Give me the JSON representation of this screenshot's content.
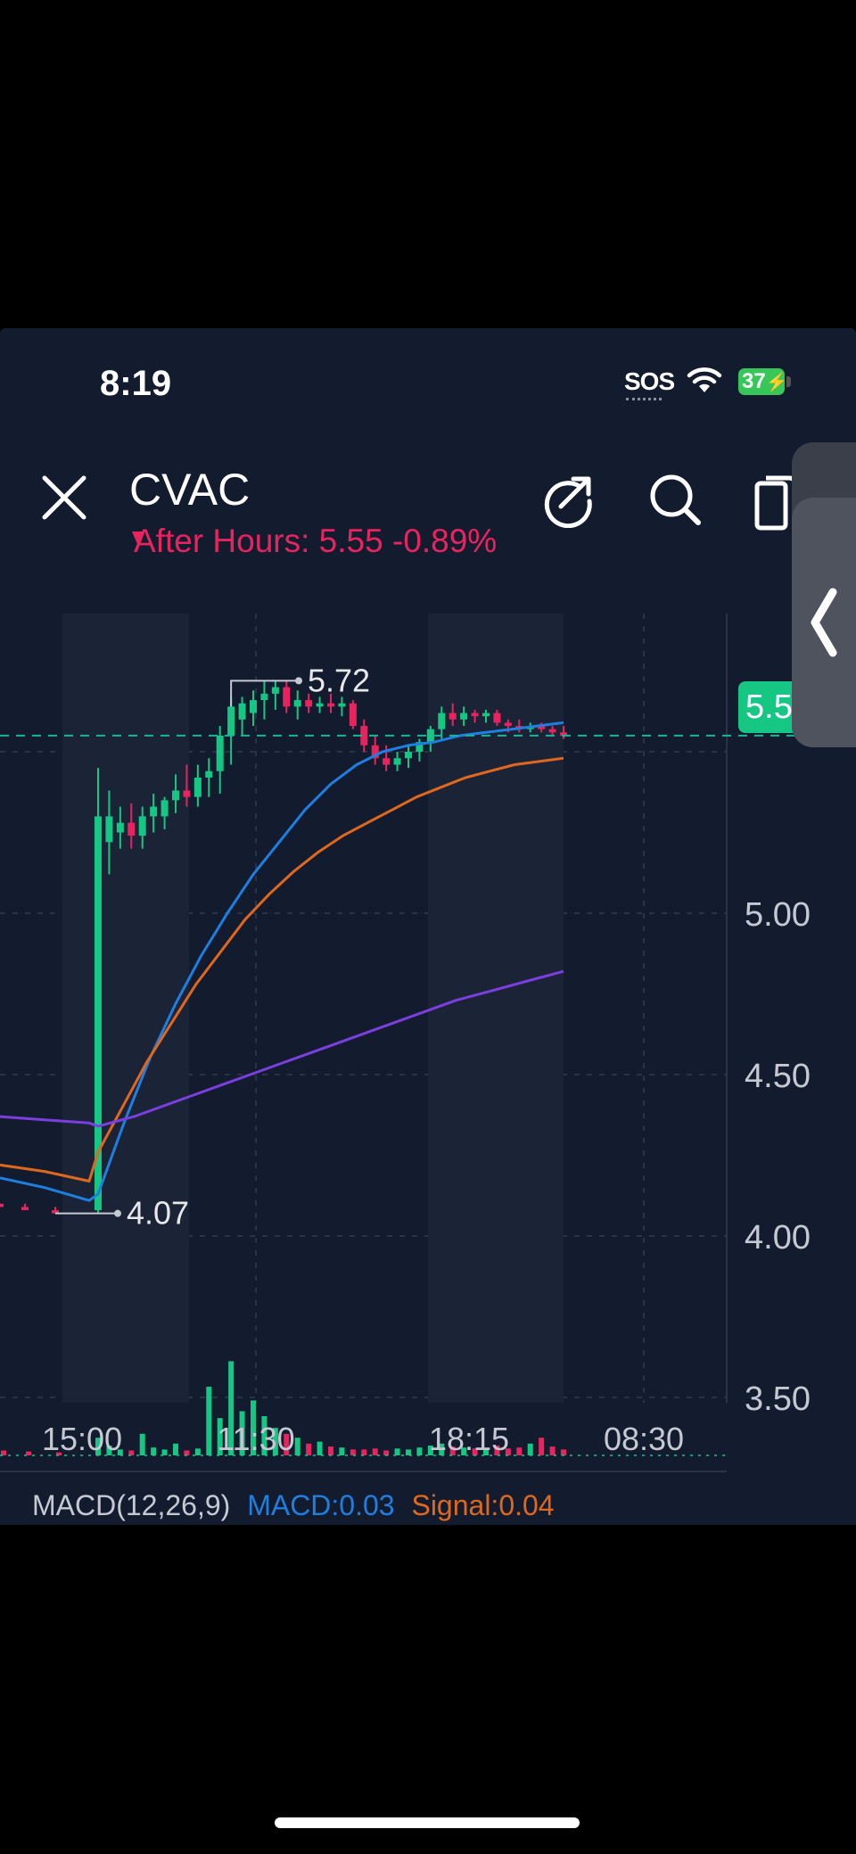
{
  "status_bar": {
    "time": "8:19",
    "sos": "SOS",
    "battery": "37"
  },
  "header": {
    "ticker": "CVAC",
    "after_hours": "After Hours: 5.55 -0.89%",
    "icons": [
      "close-icon",
      "share-icon",
      "search-icon",
      "copy-icon",
      "chevron-left-icon"
    ]
  },
  "colors": {
    "background": "#131b2e",
    "up": "#16c784",
    "down": "#e8245f",
    "ma_short": "#1e7fe0",
    "ma_mid": "#e0681e",
    "ma_long": "#7b3fe0",
    "accent_text": "#e8245f"
  },
  "chart_data": {
    "type": "candlestick",
    "y_ticks": [
      "5.00",
      "4.50",
      "4.00",
      "3.50"
    ],
    "x_ticks": [
      "15:00",
      "11:30",
      "18:15",
      "08:30"
    ],
    "last_price_label": "5.5",
    "last_price": 5.55,
    "high_label": "5.72",
    "high": 5.72,
    "low_label": "4.07",
    "low": 4.07,
    "ylim": [
      3.4,
      5.95
    ],
    "candles": [
      [
        4.1,
        4.1,
        4.09,
        4.09
      ],
      [
        4.09,
        4.1,
        4.08,
        4.08
      ],
      [
        4.08,
        4.09,
        4.07,
        4.07
      ],
      [
        4.08,
        5.45,
        4.07,
        5.3
      ],
      [
        5.22,
        5.38,
        5.12,
        5.3
      ],
      [
        5.25,
        5.33,
        5.2,
        5.28
      ],
      [
        5.28,
        5.34,
        5.2,
        5.24
      ],
      [
        5.24,
        5.33,
        5.2,
        5.3
      ],
      [
        5.3,
        5.37,
        5.25,
        5.33
      ],
      [
        5.3,
        5.36,
        5.26,
        5.35
      ],
      [
        5.35,
        5.43,
        5.31,
        5.38
      ],
      [
        5.38,
        5.46,
        5.33,
        5.36
      ],
      [
        5.36,
        5.46,
        5.33,
        5.42
      ],
      [
        5.42,
        5.48,
        5.36,
        5.44
      ],
      [
        5.44,
        5.58,
        5.37,
        5.55
      ],
      [
        5.55,
        5.67,
        5.46,
        5.64
      ],
      [
        5.6,
        5.67,
        5.55,
        5.65
      ],
      [
        5.62,
        5.69,
        5.58,
        5.66
      ],
      [
        5.66,
        5.72,
        5.6,
        5.68
      ],
      [
        5.68,
        5.72,
        5.63,
        5.7
      ],
      [
        5.7,
        5.72,
        5.62,
        5.64
      ],
      [
        5.64,
        5.69,
        5.6,
        5.66
      ],
      [
        5.66,
        5.68,
        5.62,
        5.64
      ],
      [
        5.64,
        5.67,
        5.62,
        5.65
      ],
      [
        5.65,
        5.68,
        5.62,
        5.64
      ],
      [
        5.64,
        5.67,
        5.61,
        5.65
      ],
      [
        5.65,
        5.66,
        5.57,
        5.58
      ],
      [
        5.58,
        5.6,
        5.5,
        5.52
      ],
      [
        5.52,
        5.55,
        5.46,
        5.48
      ],
      [
        5.48,
        5.52,
        5.44,
        5.46
      ],
      [
        5.46,
        5.5,
        5.44,
        5.48
      ],
      [
        5.48,
        5.52,
        5.45,
        5.5
      ],
      [
        5.5,
        5.54,
        5.47,
        5.53
      ],
      [
        5.53,
        5.58,
        5.5,
        5.57
      ],
      [
        5.57,
        5.64,
        5.54,
        5.62
      ],
      [
        5.62,
        5.65,
        5.58,
        5.6
      ],
      [
        5.6,
        5.64,
        5.58,
        5.62
      ],
      [
        5.62,
        5.63,
        5.59,
        5.61
      ],
      [
        5.61,
        5.63,
        5.59,
        5.62
      ],
      [
        5.62,
        5.63,
        5.58,
        5.59
      ],
      [
        5.59,
        5.6,
        5.56,
        5.58
      ],
      [
        5.58,
        5.6,
        5.56,
        5.57
      ],
      [
        5.57,
        5.59,
        5.56,
        5.58
      ],
      [
        5.58,
        5.59,
        5.56,
        5.57
      ],
      [
        5.57,
        5.58,
        5.55,
        5.56
      ],
      [
        5.56,
        5.58,
        5.54,
        5.55
      ]
    ],
    "volume": [
      5,
      4,
      3,
      18,
      10,
      6,
      5,
      22,
      8,
      6,
      12,
      5,
      7,
      70,
      38,
      96,
      45,
      56,
      40,
      28,
      22,
      18,
      12,
      14,
      9,
      8,
      6,
      6,
      7,
      5,
      7,
      6,
      8,
      10,
      12,
      9,
      8,
      7,
      6,
      10,
      7,
      8,
      12,
      18,
      9,
      6
    ],
    "ma_short": [
      4.18,
      4.15,
      4.11,
      4.13,
      4.35,
      4.55,
      4.72,
      4.87,
      5.0,
      5.12,
      5.22,
      5.32,
      5.4,
      5.46,
      5.5,
      5.52,
      5.53,
      5.55,
      5.56,
      5.57,
      5.58,
      5.59
    ],
    "ma_mid": [
      4.22,
      4.2,
      4.17,
      4.26,
      4.4,
      4.54,
      4.66,
      4.78,
      4.88,
      4.98,
      5.06,
      5.13,
      5.19,
      5.24,
      5.28,
      5.32,
      5.36,
      5.39,
      5.42,
      5.44,
      5.46,
      5.47,
      5.48
    ],
    "ma_long": [
      4.37,
      4.36,
      4.35,
      4.34,
      4.37,
      4.41,
      4.45,
      4.49,
      4.53,
      4.57,
      4.61,
      4.65,
      4.69,
      4.73,
      4.76,
      4.79,
      4.82
    ]
  },
  "macd": {
    "label": "MACD(12,26,9)",
    "macd": "MACD:0.03",
    "signal": "Signal:0.04"
  }
}
